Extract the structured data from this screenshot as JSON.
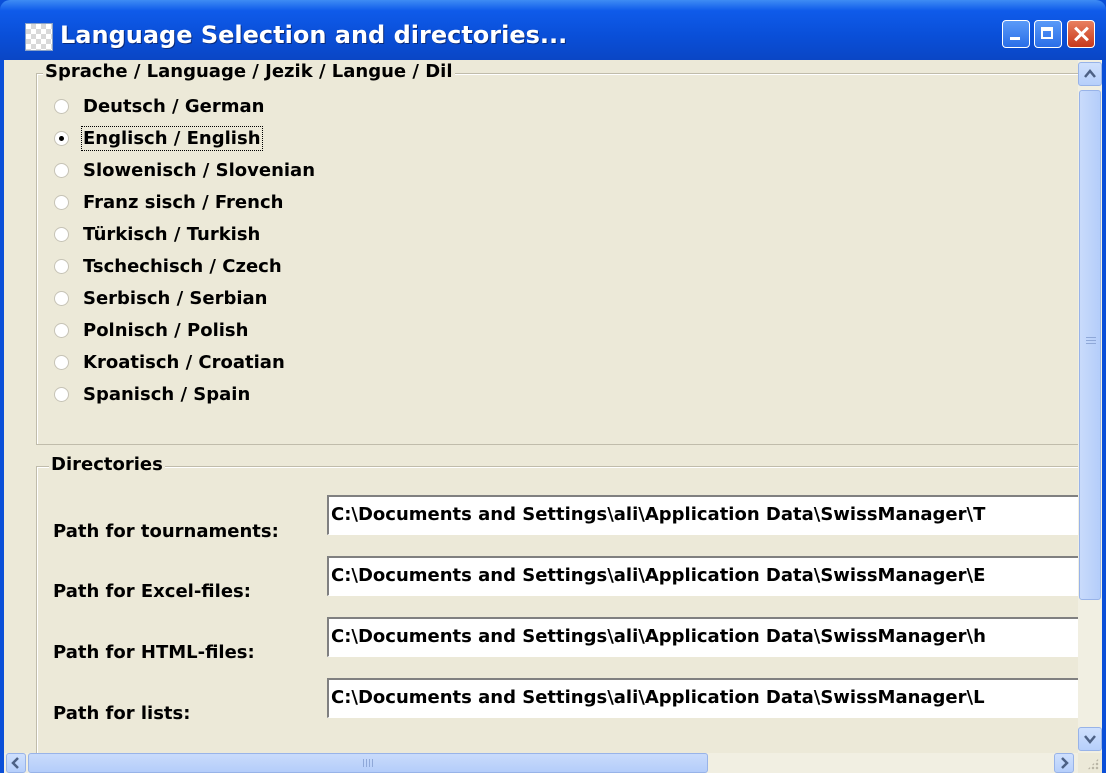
{
  "window": {
    "title": "Language Selection and directories..."
  },
  "language_group": {
    "legend": "Sprache / Language / Jezik / Langue / Dil",
    "options": [
      {
        "label": "Deutsch / German",
        "checked": false
      },
      {
        "label": "Englisch / English",
        "checked": true
      },
      {
        "label": "Slowenisch / Slovenian",
        "checked": false
      },
      {
        "label": "Franz sisch / French",
        "checked": false
      },
      {
        "label": "Türkisch / Turkish",
        "checked": false
      },
      {
        "label": "Tschechisch / Czech",
        "checked": false
      },
      {
        "label": "Serbisch / Serbian",
        "checked": false
      },
      {
        "label": "Polnisch / Polish",
        "checked": false
      },
      {
        "label": "Kroatisch / Croatian",
        "checked": false
      },
      {
        "label": "Spanisch / Spain",
        "checked": false
      }
    ]
  },
  "directories_group": {
    "legend": "Directories",
    "fields": [
      {
        "label": "Path for tournaments:",
        "value": "C:\\Documents and Settings\\ali\\Application Data\\SwissManager\\T"
      },
      {
        "label": "Path for Excel-files:",
        "value": "C:\\Documents and Settings\\ali\\Application Data\\SwissManager\\E"
      },
      {
        "label": "Path for HTML-files:",
        "value": "C:\\Documents and Settings\\ali\\Application Data\\SwissManager\\h"
      },
      {
        "label": "Path for lists:",
        "value": "C:\\Documents and Settings\\ali\\Application Data\\SwissManager\\L"
      }
    ]
  },
  "colors": {
    "titlebar": "#0a4fd8",
    "client_bg": "#ece9d8",
    "close_button": "#c8381a"
  }
}
